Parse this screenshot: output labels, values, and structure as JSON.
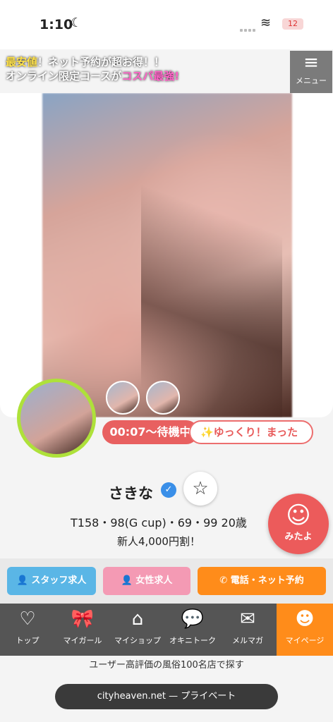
{
  "status": {
    "time": "1:10",
    "battery": "12"
  },
  "promo": {
    "line1_a": "最安値",
    "line1_b": "！ネット予約が超お得！！",
    "line2_a": "オンライン限定コースが",
    "line2_b": "コスパ最強!"
  },
  "menu": {
    "label": "メニュー"
  },
  "profile": {
    "wait_status": "00:07〜待機中",
    "message": "✨ゆっくり！まった",
    "name": "さきな",
    "stats": "T158・98(G cup)・69・99  20歳",
    "discount": "新人4,000円割！"
  },
  "mitayo": {
    "label": "みたよ"
  },
  "actions": {
    "staff": "スタッフ求人",
    "female": "女性求人",
    "reserve": "電話・ネット予約"
  },
  "nav": [
    {
      "label": "トップ",
      "icon": "my-heaven-icon"
    },
    {
      "label": "マイガール",
      "icon": "ribbon-icon"
    },
    {
      "label": "マイショップ",
      "icon": "shop-icon"
    },
    {
      "label": "オキニトーク",
      "icon": "chat-icon"
    },
    {
      "label": "メルマガ",
      "icon": "mail-icon"
    },
    {
      "label": "マイページ",
      "icon": "avatar-icon"
    }
  ],
  "footer": {
    "text": "ユーザー高評価の風俗100名店で探す",
    "url": "cityheaven.net — プライベート"
  },
  "colors": {
    "accent": "#ff8c1a",
    "status_red": "#e86060",
    "avatar_ring": "#aee13a"
  }
}
